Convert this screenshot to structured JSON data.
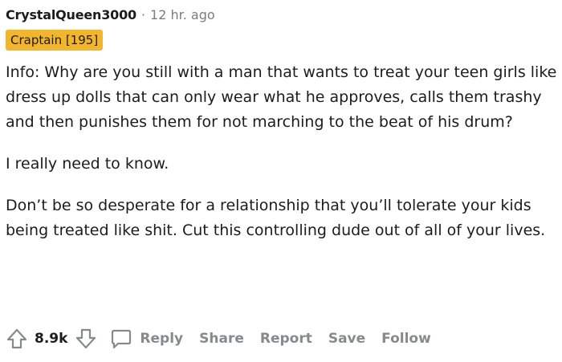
{
  "comment": {
    "author": "CrystalQueen3000",
    "separator": "·",
    "time": "12 hr. ago",
    "flair": "Craptain [195]",
    "paragraphs": [
      "Info: Why are you still with a man that wants to treat your teen girls like dress up dolls that can only wear what he approves, calls them trashy and then punishes them for not marching to the beat of his drum?",
      "I really need to know.",
      "Don’t be so desperate for a relationship that you’ll tolerate your kids being treated like shit. Cut this controlling dude out of all of your lives."
    ]
  },
  "actions": {
    "score": "8.9k",
    "reply": "Reply",
    "share": "Share",
    "report": "Report",
    "save": "Save",
    "follow": "Follow",
    "icons": {
      "upvote": "upvote-arrow-icon",
      "downvote": "downvote-arrow-icon",
      "reply": "speech-bubble-icon"
    }
  },
  "colors": {
    "flair_bg": "#f3b52b",
    "muted_text": "#878a8c",
    "text": "#1c1c1c"
  }
}
